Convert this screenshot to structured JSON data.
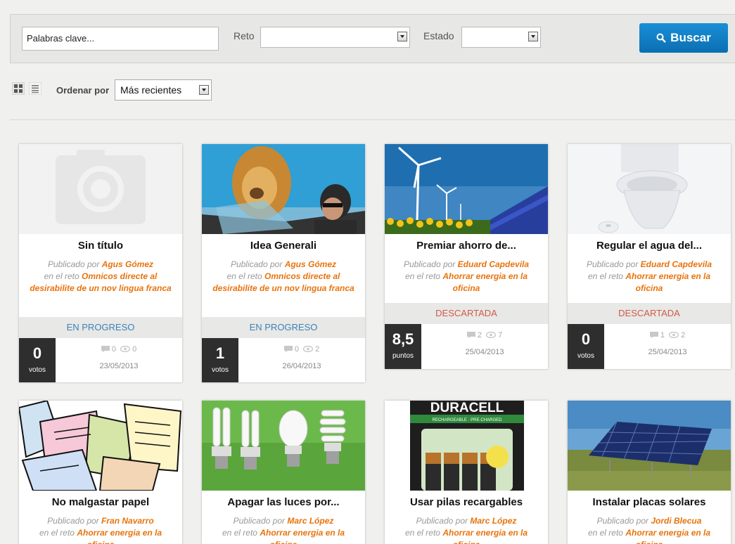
{
  "search": {
    "placeholder": "Palabras clave...",
    "reto_label": "Reto",
    "estado_label": "Estado",
    "button_label": "Buscar"
  },
  "toolbar": {
    "order_label": "Ordenar por",
    "order_value": "Más recientes"
  },
  "ideas": [
    {
      "title": "Sin título",
      "by_prefix": "Publicado por",
      "author": "Agus Gómez",
      "challenge_prefix": "en el reto",
      "challenge": "Omnicos directe al desirabilite de un nov lingua franca",
      "status": "EN PROGRESO",
      "score": "0",
      "score_unit": "votos",
      "comments": "0",
      "views": "0",
      "date": "23/05/2013"
    },
    {
      "title": "Idea Generali",
      "by_prefix": "Publicado por",
      "author": "Agus Gómez",
      "challenge_prefix": "en el reto",
      "challenge": "Omnicos directe al desirabilite de un nov lingua franca",
      "status": "EN PROGRESO",
      "score": "1",
      "score_unit": "votos",
      "comments": "0",
      "views": "2",
      "date": "26/04/2013"
    },
    {
      "title": "Premiar ahorro de...",
      "by_prefix": "Publicado por",
      "author": "Eduard Capdevila",
      "challenge_prefix": "en el reto",
      "challenge": "Ahorrar energia en la oficina",
      "status": "DESCARTADA",
      "score": "8,5",
      "score_unit": "puntos",
      "comments": "2",
      "views": "7",
      "date": "25/04/2013"
    },
    {
      "title": "Regular el agua del...",
      "by_prefix": "Publicado por",
      "author": "Eduard Capdevila",
      "challenge_prefix": "en el reto",
      "challenge": "Ahorrar energia en la oficina",
      "status": "DESCARTADA",
      "score": "0",
      "score_unit": "votos",
      "comments": "1",
      "views": "2",
      "date": "25/04/2013"
    },
    {
      "title": "No malgastar papel",
      "by_prefix": "Publicado por",
      "author": "Fran Navarro",
      "challenge_prefix": "en el reto",
      "challenge": "Ahorrar energia en la oficina"
    },
    {
      "title": "Apagar las luces por...",
      "by_prefix": "Publicado por",
      "author": "Marc López",
      "challenge_prefix": "en el reto",
      "challenge": "Ahorrar energia en la oficina"
    },
    {
      "title": "Usar pilas recargables",
      "by_prefix": "Publicado por",
      "author": "Marc López",
      "challenge_prefix": "en el reto",
      "challenge": "Ahorrar energia en la oficina",
      "image_text": "DURACELL",
      "image_subtext": "RECHARGEABLE · PRE-CHARGED"
    },
    {
      "title": "Instalar placas solares",
      "by_prefix": "Publicado por",
      "author": "Jordi Blecua",
      "challenge_prefix": "en el reto",
      "challenge": "Ahorrar energia en la oficina"
    }
  ],
  "colors": {
    "accent": "#e8730c",
    "progress": "#3b82b9",
    "discarded": "#d05a4a",
    "button": "#1180c9"
  }
}
